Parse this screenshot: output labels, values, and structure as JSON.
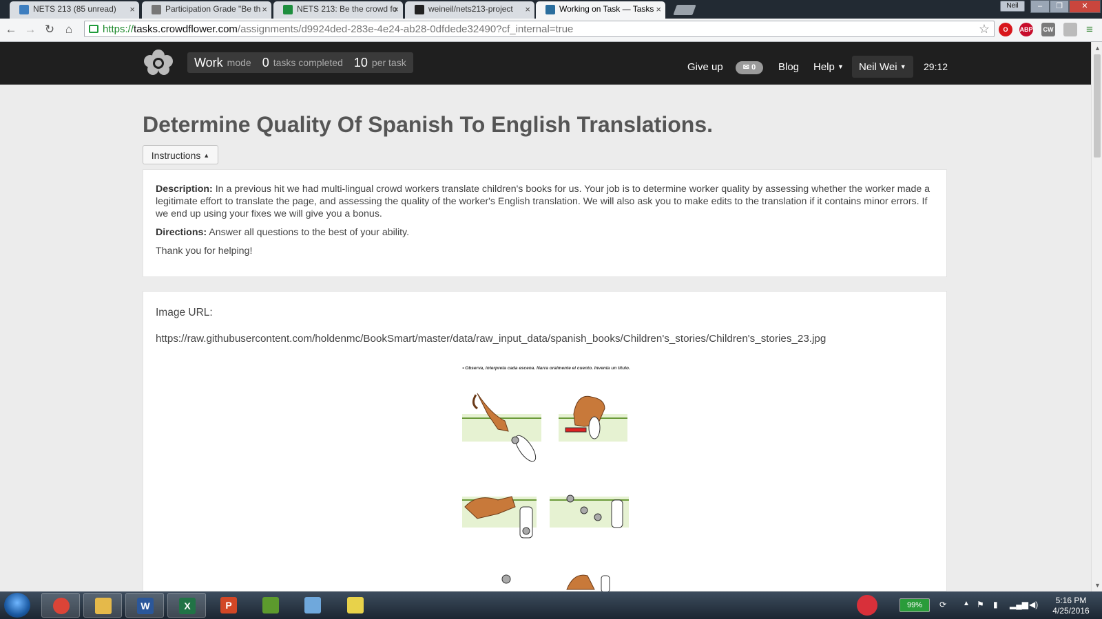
{
  "browser": {
    "tabs": [
      {
        "title": "NETS 213 (85 unread)",
        "icon": "piazza-icon",
        "color": "#3e7ebf",
        "active": false
      },
      {
        "title": "Participation Grade \"Be th",
        "icon": "document-icon",
        "color": "#777777",
        "active": false
      },
      {
        "title": "NETS 213: Be the crowd fo",
        "icon": "sheets-icon",
        "color": "#1e8e3e",
        "active": false
      },
      {
        "title": "weineil/nets213-project",
        "icon": "github-icon",
        "color": "#222222",
        "active": false
      },
      {
        "title": "Working on Task — Tasks",
        "icon": "crowdflower-icon",
        "color": "#2a6e9e",
        "active": true
      }
    ],
    "window_user": "Neil",
    "url_scheme": "https://",
    "url_domain": "tasks.crowdflower.com",
    "url_path": "/assignments/d9924ded-283e-4e24-ab28-0dfdede32490?cf_internal=true",
    "extensions": [
      {
        "name": "opera-icon",
        "label": "O",
        "color": "#d8161b"
      },
      {
        "name": "adblock-icon",
        "label": "ABP",
        "color": "#c70d2c"
      },
      {
        "name": "cw-icon",
        "label": "CW",
        "color": "#7a7a7a"
      },
      {
        "name": "extension-icon",
        "label": "",
        "color": "#bbbbbb"
      }
    ]
  },
  "header": {
    "mode_word": "Work",
    "mode_label": "mode",
    "tasks_completed_count": "0",
    "tasks_completed_label": "tasks completed",
    "per_task_count": "10",
    "per_task_label": "per task",
    "give_up": "Give up",
    "messages_count": "0",
    "blog": "Blog",
    "help": "Help",
    "user": "Neil Wei",
    "timer": "29:12"
  },
  "page": {
    "title": "Determine Quality Of Spanish To English Translations.",
    "instructions_button": "Instructions",
    "description_label": "Description:",
    "description_text": "In a previous hit we had multi-lingual crowd workers translate children's books for us. Your job is to determine worker quality by assessing whether the worker made a legitimate effort to translate the page, and assessing the quality of the worker's English translation. We will also ask you to make edits to the translation if it contains minor errors. If we end up using your fixes we will give you a bonus.",
    "directions_label": "Directions:",
    "directions_text": "Answer all questions to the best of your ability.",
    "thanks": "Thank you for helping!",
    "image_url_label": "Image URL:",
    "image_url": "https://raw.githubusercontent.com/holdenmc/BookSmart/master/data/raw_input_data/spanish_books/Children's_stories/Children's_stories_23.jpg",
    "image_caption": "• Observa, interpreta cada escena. Narra oralmente el cuento. Inventa un título."
  },
  "taskbar": {
    "apps": [
      {
        "name": "chrome-icon",
        "label": "",
        "color": "#db4437",
        "open": true
      },
      {
        "name": "explorer-icon",
        "label": "",
        "color": "#e5b94a",
        "open": true
      },
      {
        "name": "word-icon",
        "label": "W",
        "color": "#2b579a",
        "open": true
      },
      {
        "name": "excel-icon",
        "label": "X",
        "color": "#217346",
        "open": true
      },
      {
        "name": "powerpoint-icon",
        "label": "P",
        "color": "#d24726",
        "open": false
      },
      {
        "name": "project-icon",
        "label": "",
        "color": "#5c9a2d",
        "open": false
      },
      {
        "name": "notes-icon",
        "label": "",
        "color": "#6fa8dc",
        "open": false
      },
      {
        "name": "stickynotes-icon",
        "label": "",
        "color": "#e8d24a",
        "open": false
      }
    ],
    "battery": "99%",
    "time": "5:16 PM",
    "date": "4/25/2016"
  }
}
